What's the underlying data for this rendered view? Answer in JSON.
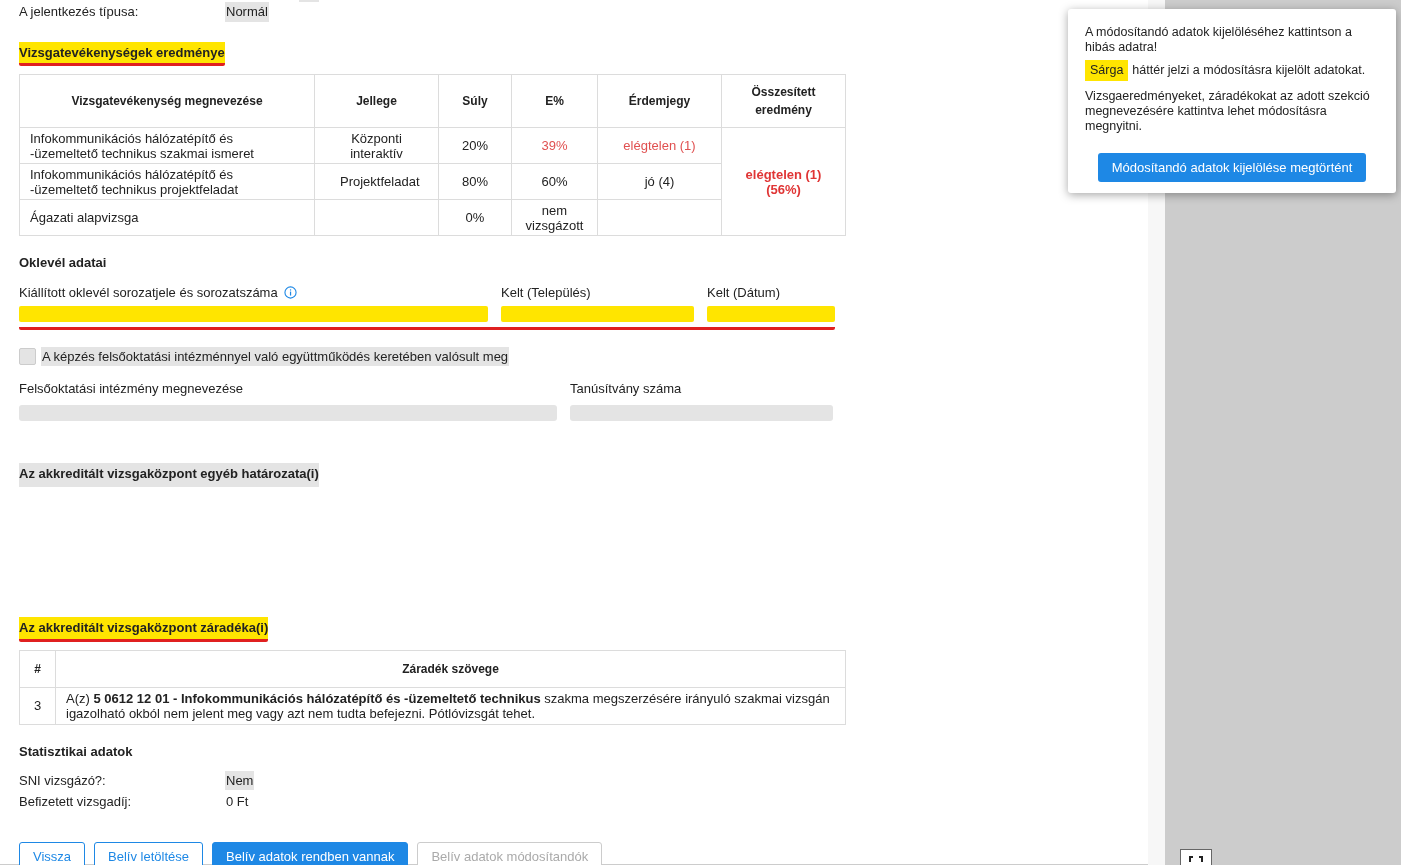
{
  "info_rows": [
    {
      "label": "A jelentkezés típusa:",
      "value": "Normál",
      "clickable": true,
      "marked": false
    }
  ],
  "results": {
    "title": "Vizsgatevékenységek eredménye",
    "marked": true,
    "columns": [
      "Vizsgatevékenység megnevezése",
      "Jellege",
      "Súly",
      "E%",
      "Érdemjegy",
      "Összesített eredmény"
    ],
    "rows": [
      {
        "name": "Infokommunikációs hálózatépítő és -üzemeltető technikus szakmai ismeret",
        "type": "Központi interaktív",
        "weight": "20%",
        "percent": {
          "text": "39%",
          "alert": true
        },
        "grade": {
          "text": "elégtelen (1)",
          "alert": true
        }
      },
      {
        "name": "Infokommunikációs hálózatépítő és -üzemeltető technikus projektfeladat",
        "type": "Projektfeladat",
        "weight": "80%",
        "percent": {
          "text": "60%",
          "alert": false
        },
        "grade": {
          "text": "jó (4)",
          "alert": false
        }
      },
      {
        "name": "Ágazati alapvizsga",
        "type": "",
        "weight": "0%",
        "percent": {
          "text": "nem vizsgázott",
          "alert": false
        }
      }
    ],
    "summary": {
      "text": "elégtelen (1) (56%)",
      "alert": true
    }
  },
  "diploma": {
    "title": "Oklevél adatai",
    "marked": true,
    "fields": [
      {
        "label": "Kiállított oklevél sorozatjele és sorozatszáma",
        "info": true
      },
      {
        "label": "Kelt (Település)",
        "info": false
      },
      {
        "label": "Kelt (Dátum)",
        "info": false
      }
    ]
  },
  "cooperation": {
    "label": "A képzés felsőoktatási intézménnyel való együttműködés keretében valósult meg",
    "checked": false,
    "fields": [
      {
        "label": "Felsőoktatási intézmény megnevezése",
        "disabled": true
      },
      {
        "label": "Tanúsítvány száma",
        "disabled": true
      }
    ]
  },
  "decisions": {
    "title": "Az akkreditált vizsgaközpont egyéb határozata(i)",
    "marked": false
  },
  "clauses": {
    "title": "Az akkreditált vizsgaközpont záradéka(i)",
    "marked": true,
    "columns": [
      "#",
      "Záradék szövege"
    ],
    "rows": [
      {
        "number": "3",
        "text": "A(z) **5 0612 12 01 - Infokommunikációs hálózatépítő és -üzemeltető technikus** szakma megszerzésére irányuló szakmai vizsgán igazolható okból nem jelent meg vagy azt nem tudta befejezni. Pótlóvizsgát tehet."
      }
    ]
  },
  "statistics": {
    "title": "Statisztikai adatok",
    "rows": [
      {
        "label": "SNI vizsgázó?:",
        "value": "Nem",
        "clickable": true,
        "marked": false
      },
      {
        "label": "Befizetett vizsgadíj:",
        "value": "0 Ft",
        "clickable": false,
        "marked": false
      }
    ]
  },
  "buttons": [
    {
      "label": "Vissza",
      "kind": "outline",
      "disabled": false
    },
    {
      "label": "Belív letöltése",
      "kind": "outline",
      "disabled": false
    },
    {
      "label": "Belív adatok rendben vannak",
      "kind": "primary",
      "disabled": false
    },
    {
      "label": "Belív adatok módosítandók",
      "kind": "outline",
      "disabled": true
    }
  ],
  "popup": {
    "line1": "A módosítandó adatok kijelöléséhez kattintson a hibás adatra!",
    "badge": "Sárga",
    "line2": "háttér jelzi a módosításra kijelölt adatokat.",
    "line3": "Vizsgaeredményeket, záradékokat az adott szekció megnevezésére kattintva lehet módosításra megnyitni.",
    "button": "Módosítandó adatok kijelölése megtörtént"
  }
}
